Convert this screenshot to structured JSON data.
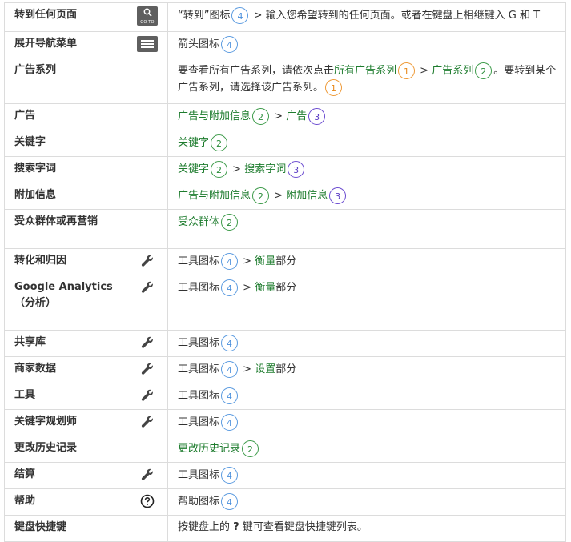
{
  "rows": [
    {
      "label": "转到任何页面",
      "icon": "goto-search-icon",
      "icon_text": "GO TO",
      "desc": {
        "pre": "“转到”图标",
        "n1": "4",
        "post": " > 输入您希望转到的任何页面。或者在键盘上相继键入 G 和 T"
      }
    },
    {
      "label": "展开导航菜单",
      "icon": "menu-icon",
      "desc": {
        "pre": "箭头图标",
        "n1": "4"
      }
    },
    {
      "label": "广告系列",
      "icon": "",
      "desc": {
        "pre": "要查看所有广告系列，请依次点击",
        "link1": "所有广告系列",
        "n1": "1",
        "sep": " > ",
        "link2": "广告系列",
        "n2": "2",
        "post": "。要转到某个广告系列，请选择该广告系列。",
        "n3": "1"
      }
    },
    {
      "label": "广告",
      "icon": "",
      "desc": {
        "link1": "广告与附加信息",
        "n1": "2",
        "sep": " > ",
        "link2": "广告",
        "n2": "3"
      }
    },
    {
      "label": "关键字",
      "icon": "",
      "desc": {
        "link1": "关键字",
        "n1": "2"
      }
    },
    {
      "label": "搜索字词",
      "icon": "",
      "desc": {
        "link1": "关键字",
        "n1": "2",
        "sep": " > ",
        "link2": "搜索字词",
        "n2": "3"
      }
    },
    {
      "label": "附加信息",
      "icon": "",
      "desc": {
        "link1": "广告与附加信息",
        "n1": "2",
        "sep": " > ",
        "link2": "附加信息",
        "n2": "3"
      }
    },
    {
      "label": "受众群体或再营销",
      "icon": "",
      "desc": {
        "link1": "受众群体",
        "n1": "2"
      }
    },
    {
      "label": "转化和归因",
      "icon": "wrench-icon",
      "desc": {
        "pre": "工具图标",
        "n1": "4",
        "sep": " > ",
        "link1": "衡量",
        "post": "部分"
      }
    },
    {
      "label": "Google Analytics（分析）",
      "icon": "wrench-icon",
      "desc": {
        "pre": "工具图标",
        "n1": "4",
        "sep": " > ",
        "link1": "衡量",
        "post": "部分"
      }
    },
    {
      "label": "共享库",
      "icon": "wrench-icon",
      "desc": {
        "pre": "工具图标",
        "n1": "4"
      }
    },
    {
      "label": "商家数据",
      "icon": "wrench-icon",
      "desc": {
        "pre": "工具图标",
        "n1": "4",
        "sep": " > ",
        "link1": "设置",
        "post": "部分"
      }
    },
    {
      "label": "工具",
      "icon": "wrench-icon",
      "desc": {
        "pre": "工具图标",
        "n1": "4"
      }
    },
    {
      "label": "关键字规划师",
      "icon": "wrench-icon",
      "desc": {
        "pre": "工具图标",
        "n1": "4"
      }
    },
    {
      "label": "更改历史记录",
      "icon": "",
      "desc": {
        "link1": "更改历史记录",
        "n1": "2"
      }
    },
    {
      "label": "结算",
      "icon": "wrench-icon",
      "desc": {
        "pre": "工具图标",
        "n1": "4"
      }
    },
    {
      "label": "帮助",
      "icon": "help-icon",
      "desc": {
        "pre": "帮助图标",
        "n1": "4"
      }
    },
    {
      "label": "键盘快捷键",
      "icon": "",
      "desc": {
        "pre": "按键盘上的 ",
        "key": "?",
        "post": " 键可查看键盘快捷键列表。"
      }
    }
  ],
  "colors": {
    "border": "#dcdcdc",
    "link": "#1e7c2e",
    "step_blue": "#4a8fdc",
    "step_orange": "#e8891a",
    "step_green": "#2a8c3a",
    "step_purple": "#5b3cc4"
  }
}
